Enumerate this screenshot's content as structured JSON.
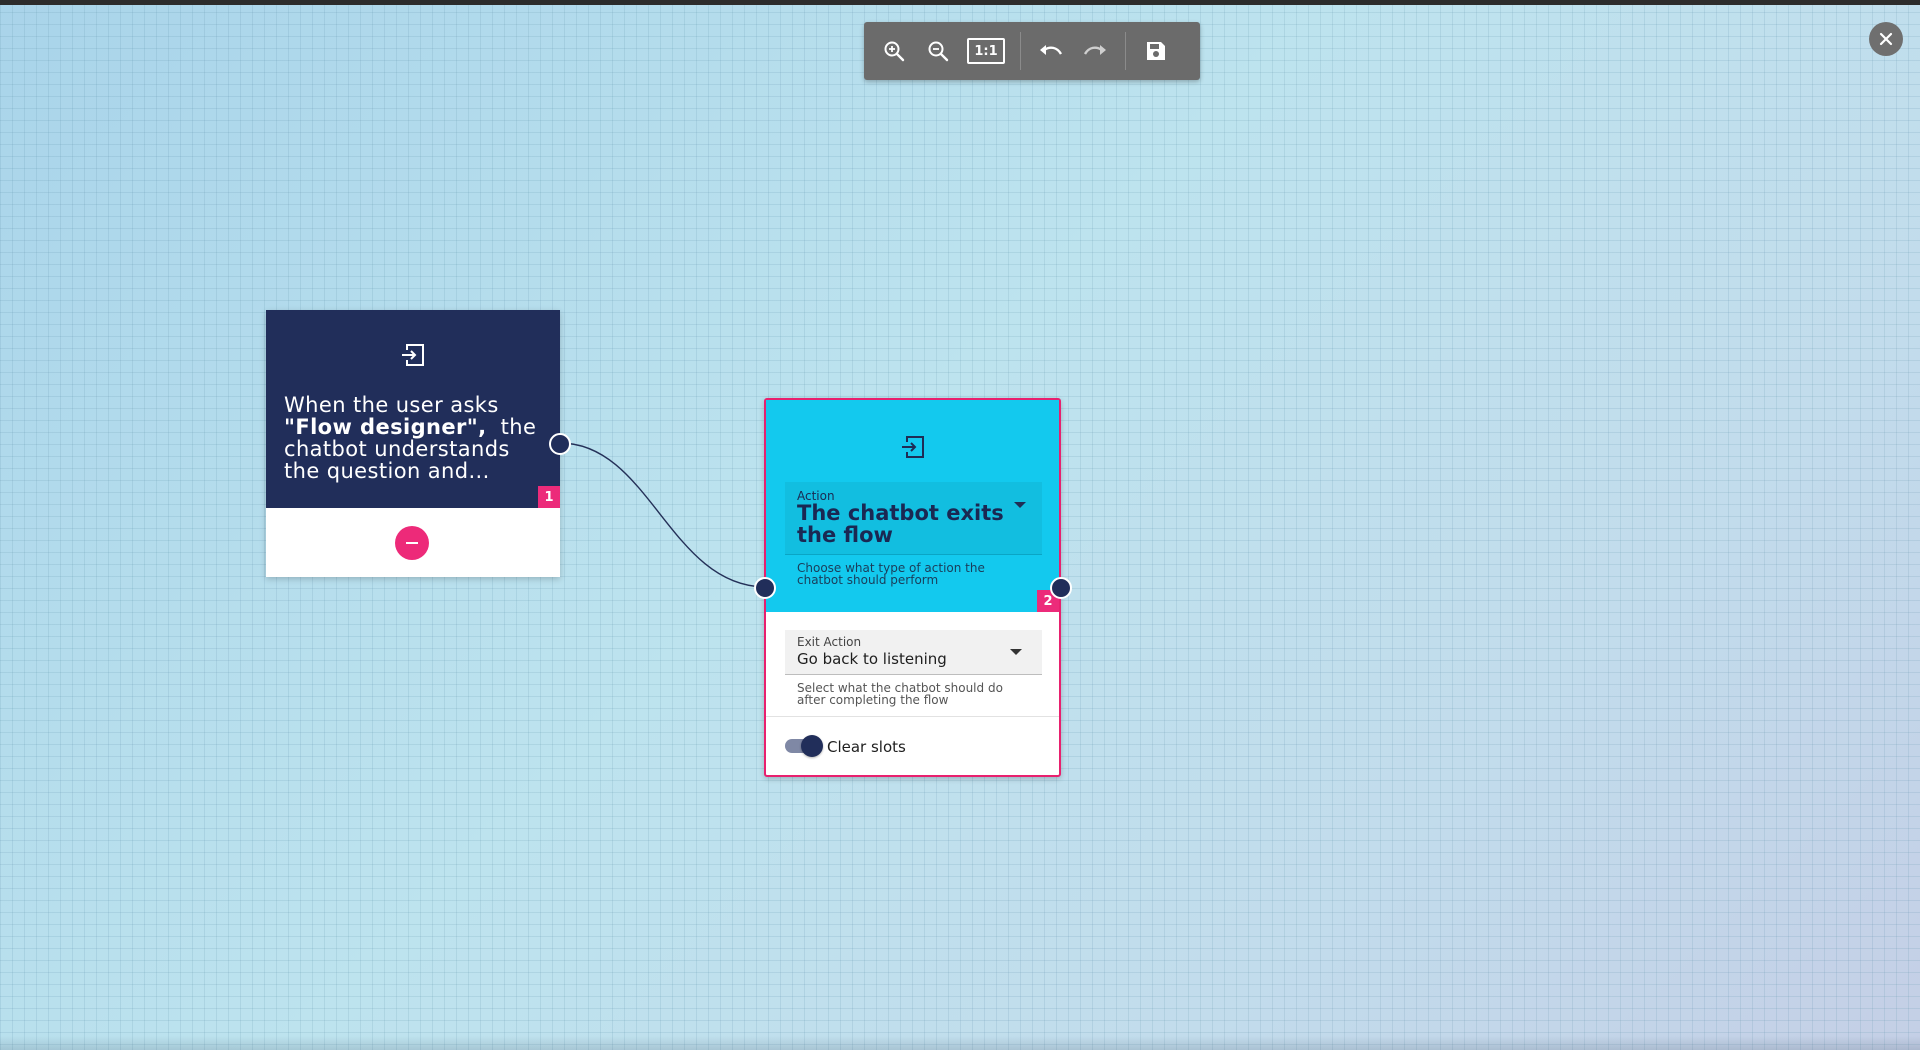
{
  "toolbar": {
    "zoom_in_icon": "zoom-in-icon",
    "zoom_out_icon": "zoom-out-icon",
    "fit_label": "1:1",
    "undo_icon": "undo-icon",
    "redo_icon": "redo-icon",
    "save_icon": "save-icon"
  },
  "close_icon": "close-icon",
  "nodes": [
    {
      "number": "1",
      "icon": "exit-icon",
      "text_before": "When the user asks ",
      "text_bold": "\"Flow designer\",",
      "text_after": "  the chatbot understands the question and...",
      "remove_icon": "minus-icon"
    },
    {
      "number": "2",
      "icon": "exit-icon",
      "action_label": "Action",
      "action_value": "The chatbot exits the flow",
      "action_help": "Choose what type of action the chatbot should perform",
      "exit_label": "Exit Action",
      "exit_value": "Go back to listening",
      "exit_help": "Select what the chatbot should do after completing the flow",
      "clear_slots_label": "Clear slots",
      "clear_slots_on": true
    }
  ],
  "colors": {
    "canvas": "#b7dcea",
    "node_dark": "#212e5a",
    "node_cyan": "#13c9ee",
    "accent_pink": "#ec2b7a",
    "toolbar": "#6b6b6b"
  }
}
